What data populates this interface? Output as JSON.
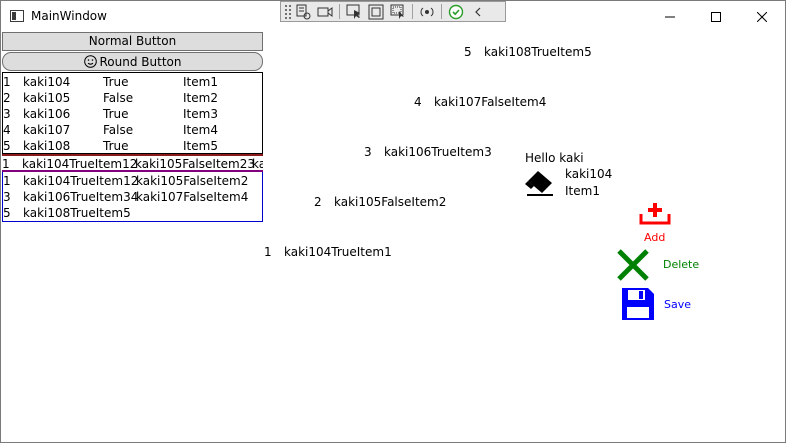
{
  "window": {
    "title": "MainWindow",
    "minimize_icon": "minimize-icon",
    "maximize_icon": "maximize-icon",
    "close_icon": "close-icon"
  },
  "debug_toolbar": {
    "icons": [
      "live-visual-tree-icon",
      "video-camera-icon",
      "select-element-icon",
      "display-layout-adorners-icon",
      "track-focus-icon",
      "hot-reload-icon",
      "check-icon",
      "collapse-chevron-icon"
    ]
  },
  "buttons": {
    "normal_label": "Normal Button",
    "round_label": "Round Button",
    "round_icon": "smiley-face-icon"
  },
  "items_list": [
    {
      "id": "1",
      "name": "kaki104",
      "flag": "True",
      "item": "Item1"
    },
    {
      "id": "2",
      "name": "kaki105",
      "flag": "False",
      "item": "Item2"
    },
    {
      "id": "3",
      "name": "kaki106",
      "flag": "True",
      "item": "Item3"
    },
    {
      "id": "4",
      "name": "kaki107",
      "flag": "False",
      "item": "Item4"
    },
    {
      "id": "5",
      "name": "kaki108",
      "flag": "True",
      "item": "Item5"
    }
  ],
  "horizontal_list": {
    "id": "1",
    "cells": [
      "kaki104TrueItem12",
      "kaki105FalseItem23",
      "ka"
    ]
  },
  "wrap_list": {
    "row1": {
      "id": "1",
      "a": "kaki104TrueItem12",
      "b": "kaki105FalseItem2"
    },
    "row2": {
      "id": "3",
      "a": "kaki106TrueItem34",
      "b": "kaki107FalseItem4"
    },
    "row3": {
      "id": "5",
      "a": "kaki108TrueItem5"
    }
  },
  "diagonal_items": [
    {
      "id": "5",
      "text": "kaki108TrueItem5"
    },
    {
      "id": "4",
      "text": "kaki107FalseItem4"
    },
    {
      "id": "3",
      "text": "kaki106TrueItem3"
    },
    {
      "id": "2",
      "text": "kaki105FalseItem2"
    },
    {
      "id": "1",
      "text": "kaki104TrueItem1"
    }
  ],
  "detail": {
    "greeting": "Hello kaki",
    "icon": "eraser-icon",
    "name": "kaki104",
    "item": "Item1"
  },
  "actions": {
    "add": {
      "label": "Add",
      "icon": "add-tray-icon",
      "color": "#ff0000"
    },
    "delete": {
      "label": "Delete",
      "icon": "close-x-icon",
      "color": "#008000"
    },
    "save": {
      "label": "Save",
      "icon": "floppy-disk-icon",
      "color": "#0000ff"
    }
  }
}
